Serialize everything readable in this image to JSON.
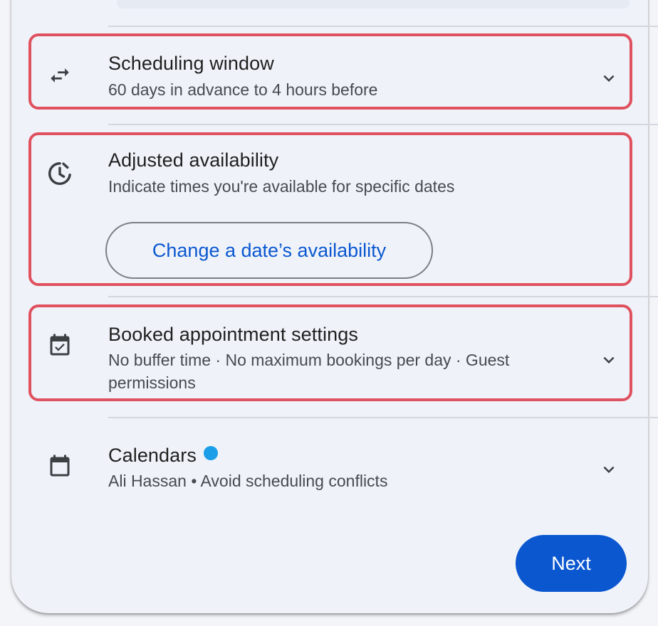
{
  "colors": {
    "accent": "#0b57d0",
    "highlight": "#e0515f",
    "calendar_dot": "#1a9ee8"
  },
  "sections": {
    "scheduling_window": {
      "title": "Scheduling window",
      "subtitle": "60 days in advance to 4 hours before",
      "icon": "swap-arrows-icon"
    },
    "adjusted_availability": {
      "title": "Adjusted availability",
      "subtitle": "Indicate times you're available for specific dates",
      "button_label": "Change a date’s availability",
      "icon": "schedule-clock-icon"
    },
    "booked_settings": {
      "title": "Booked appointment settings",
      "subtitle": "No buffer time · No maximum bookings per day · Guest permissions",
      "icon": "event-available-icon"
    },
    "calendars": {
      "title": "Calendars",
      "subtitle": "Ali Hassan • Avoid scheduling conflicts",
      "icon": "calendar-icon"
    }
  },
  "footer": {
    "next_label": "Next"
  }
}
